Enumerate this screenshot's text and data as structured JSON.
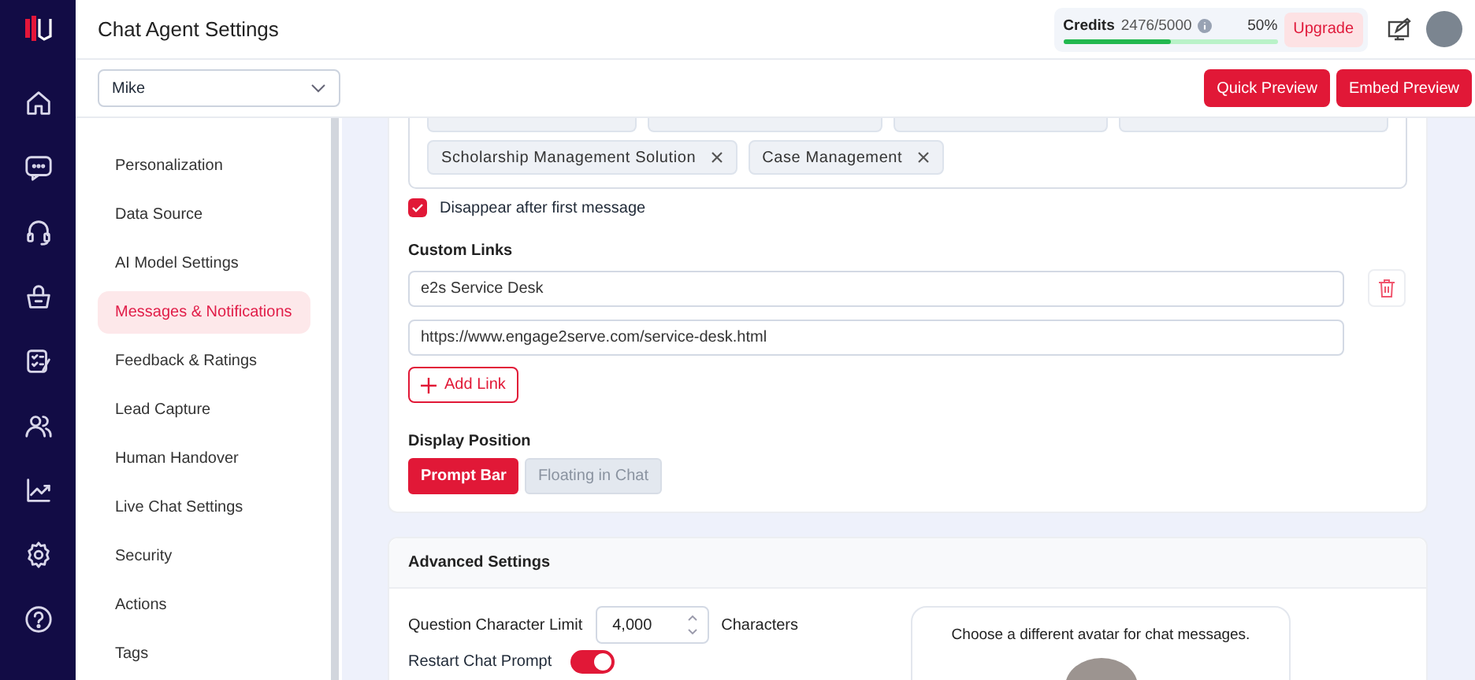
{
  "header": {
    "title": "Chat Agent Settings",
    "credits": {
      "label": "Credits",
      "value": "2476/5000",
      "percent": "50%",
      "level": 0.5
    },
    "upgrade": "Upgrade"
  },
  "rail": [
    {
      "kind": "home"
    },
    {
      "kind": "chat"
    },
    {
      "kind": "headset"
    },
    {
      "kind": "basket"
    },
    {
      "kind": "checklist"
    },
    {
      "kind": "users"
    },
    {
      "kind": "chart"
    },
    {
      "kind": "settings"
    },
    {
      "kind": "help"
    }
  ],
  "agent_select": {
    "value": "Mike"
  },
  "actions": [
    "Quick Preview",
    "Embed Preview"
  ],
  "sidebar": {
    "items": [
      {
        "label": "Personalization",
        "selected": false
      },
      {
        "label": "Data Source",
        "selected": false
      },
      {
        "label": "AI Model Settings",
        "selected": false
      },
      {
        "label": "Messages & Notifications",
        "selected": true
      },
      {
        "label": "Feedback & Ratings",
        "selected": false
      },
      {
        "label": "Lead Capture",
        "selected": false
      },
      {
        "label": "Human Handover",
        "selected": false
      },
      {
        "label": "Live Chat Settings",
        "selected": false
      },
      {
        "label": "Security",
        "selected": false
      },
      {
        "label": "Actions",
        "selected": false
      },
      {
        "label": "Tags",
        "selected": false
      }
    ]
  },
  "tags": [
    {
      "label": "Scholarship Management Solution"
    },
    {
      "label": "Case Management"
    }
  ],
  "disappear": {
    "label": "Disappear after first message",
    "checked": true
  },
  "custom_links": {
    "title": "Custom Links",
    "links": [
      {
        "value": "e2s Service Desk"
      },
      {
        "value": "https://www.engage2serve.com/service-desk.html"
      }
    ],
    "add": "Add Link"
  },
  "display_position": {
    "title": "Display Position",
    "options": [
      {
        "label": "Prompt Bar",
        "selected": true
      },
      {
        "label": "Floating in Chat",
        "selected": false
      }
    ]
  },
  "advanced": {
    "title": "Advanced Settings",
    "char_limit": {
      "label": "Question Character Limit",
      "value": "4,000",
      "unit": "Characters"
    },
    "restart": {
      "label": "Restart Chat Prompt",
      "on": true
    },
    "avatar": {
      "caption": "Choose a different avatar for chat messages."
    }
  }
}
